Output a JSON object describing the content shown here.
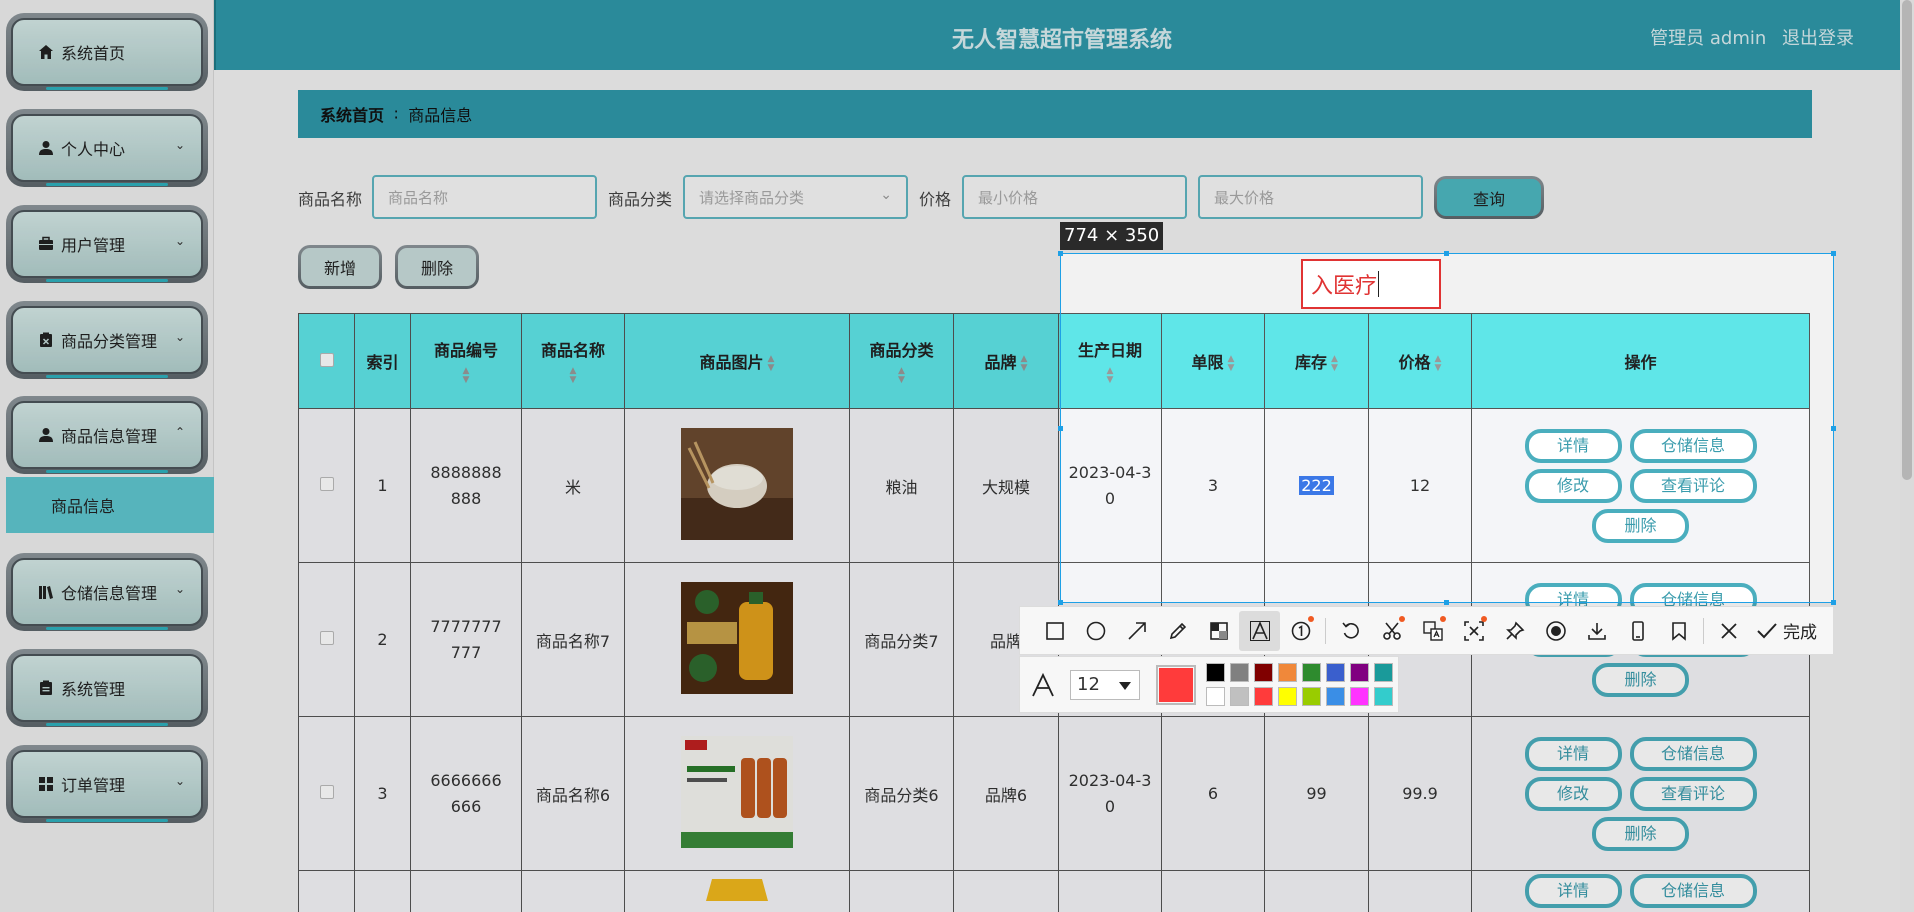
{
  "header": {
    "title": "无人智慧超市管理系统",
    "user_label": "管理员 admin",
    "logout": "退出登录"
  },
  "sidebar": {
    "items": [
      {
        "label": "系统首页",
        "icon": "home-icon"
      },
      {
        "label": "个人中心",
        "icon": "person-icon"
      },
      {
        "label": "用户管理",
        "icon": "briefcase-icon"
      },
      {
        "label": "商品分类管理",
        "icon": "clipboard-x-icon"
      },
      {
        "label": "商品信息管理",
        "icon": "person-icon"
      },
      {
        "label": "仓储信息管理",
        "icon": "books-icon"
      },
      {
        "label": "系统管理",
        "icon": "clipboard-icon"
      },
      {
        "label": "订单管理",
        "icon": "grid-icon"
      }
    ],
    "active_sub": "商品信息"
  },
  "breadcrumb": {
    "home": "系统首页",
    "separator": "∶",
    "current": "商品信息"
  },
  "search": {
    "name_label": "商品名称",
    "name_placeholder": "商品名称",
    "category_label": "商品分类",
    "category_placeholder": "请选择商品分类",
    "price_label": "价格",
    "min_placeholder": "最小价格",
    "max_placeholder": "最大价格",
    "query_button": "查询"
  },
  "actions": {
    "add": "新增",
    "delete": "删除"
  },
  "table": {
    "headers": [
      "索引",
      "商品编号",
      "商品名称",
      "商品图片",
      "商品分类",
      "品牌",
      "生产日期",
      "单限",
      "库存",
      "价格",
      "操作"
    ],
    "rows": [
      {
        "index": "1",
        "code": "8888888888",
        "name": "米",
        "category": "粮油",
        "brand": "大规模",
        "date": "2023-04-30",
        "limit": "3",
        "stock": "222",
        "price": "12"
      },
      {
        "index": "2",
        "code": "7777777777",
        "name": "商品名称7",
        "category": "商品分类7",
        "brand": "品牌",
        "date": "",
        "limit": "",
        "stock": "",
        "price": ""
      },
      {
        "index": "3",
        "code": "6666666666",
        "name": "商品名称6",
        "category": "商品分类6",
        "brand": "品牌6",
        "date": "2023-04-30",
        "limit": "6",
        "stock": "99",
        "price": "99.9"
      }
    ],
    "row_actions": {
      "detail": "详情",
      "storage": "仓储信息",
      "edit": "修改",
      "reviews": "查看评论",
      "delete": "删除"
    }
  },
  "screenshot_tool": {
    "size_label": "774 × 350",
    "text_annotation": "入医疗",
    "font_size": "12",
    "current_color": "#ff3b3b",
    "done_label": "完成",
    "palette": [
      "#000000",
      "#808080",
      "#800000",
      "#f0883a",
      "#2e8b2e",
      "#3a5fcd",
      "#800080",
      "#1a9a9a",
      "#ffffff",
      "#c0c0c0",
      "#ff3b3b",
      "#ffff00",
      "#99cc00",
      "#3a8ee6",
      "#ff33ff",
      "#33cccc"
    ]
  }
}
